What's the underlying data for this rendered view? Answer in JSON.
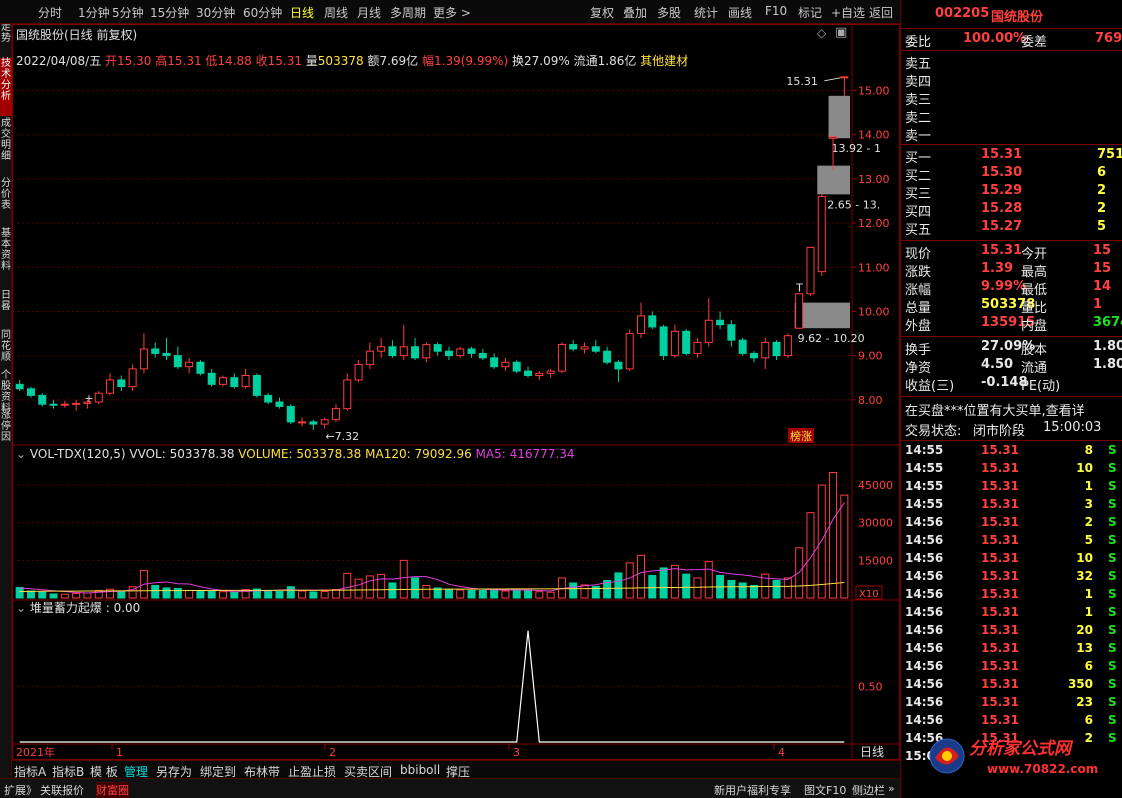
{
  "top_menu": {
    "periods": [
      "分时",
      "1分钟",
      "5分钟",
      "15分钟",
      "30分钟",
      "60分钟",
      "日线",
      "周线",
      "月线",
      "多周期",
      "更多 >"
    ],
    "active_period": "日线",
    "tools": [
      "复权",
      "叠加",
      "多股",
      "统计",
      "画线",
      "F10",
      "标记",
      "+自选",
      "返回"
    ]
  },
  "left_tabs": [
    "分时走势",
    "技术分析",
    "成交明细",
    "分价表",
    "基本资料",
    "日晷",
    "同花顺",
    "个股资料",
    "涨停因"
  ],
  "left_tab_active": 1,
  "main_header": {
    "title": "国统股份(日线 前复权)",
    "info_line": {
      "date": "2022/04/08/五",
      "open_label": "开",
      "open": "15.30",
      "high_label": "高",
      "high": "15.31",
      "low_label": "低",
      "low": "14.88",
      "close_label": "收",
      "close": "15.31",
      "vol_label": "量",
      "vol": "503378",
      "amt_label": "额",
      "amt": "7.69亿",
      "chg_label": "幅",
      "chg": "1.39(9.99%)",
      "turn_label": "换",
      "turn": "27.09%",
      "float_label": "流通",
      "float": "1.86亿",
      "sector": "其他建材"
    }
  },
  "price_axis": [
    "15.00",
    "14.00",
    "13.00",
    "12.00",
    "11.00",
    "10.00",
    "9.00",
    "8.00"
  ],
  "annotations": {
    "high_mark": "15.31",
    "low_mark": "7.32",
    "gap1": "13.92 - 1",
    "gap2": "12.65 - 13.",
    "gap3": "9.62 - 10.20",
    "tag": "榜涨"
  },
  "volume_header": {
    "name": "VOL-TDX(120,5)",
    "vvol": "VVOL: 503378.38",
    "volume": "VOLUME: 503378.38",
    "ma120": "MA120: 79092.96",
    "ma5": "MA5: 416777.34"
  },
  "volume_axis": [
    "45000",
    "30000",
    "15000"
  ],
  "volume_unit": "X10",
  "indicator_header": "堆量蓄力起爆 : 0.00",
  "indicator_axis": "0.50",
  "date_axis": [
    "2021年",
    "1",
    "2",
    "3",
    "4"
  ],
  "timeframe_label": "日线",
  "bottom_tabs": [
    "指标A",
    "指标B",
    "模 板",
    "管理",
    "另存为",
    "绑定到",
    "布林带",
    "止盈止损",
    "买卖区间",
    "bbiboll",
    "撑压"
  ],
  "bottom_active": "管理",
  "status_bar": {
    "left": [
      "扩展》",
      "关联报价",
      "财富圈"
    ],
    "right": [
      "新用户福利专享",
      "图文F10",
      "侧边栏",
      "»"
    ]
  },
  "right_panel": {
    "code": "002205",
    "name": "国统股份",
    "weibi_label": "委比",
    "weibi": "100.00%",
    "weicha_label": "委差",
    "weicha": "769",
    "sells": [
      {
        "label": "卖五",
        "price": "",
        "vol": ""
      },
      {
        "label": "卖四",
        "price": "",
        "vol": ""
      },
      {
        "label": "卖三",
        "price": "",
        "vol": ""
      },
      {
        "label": "卖二",
        "price": "",
        "vol": ""
      },
      {
        "label": "卖一",
        "price": "",
        "vol": ""
      }
    ],
    "buys": [
      {
        "label": "买一",
        "price": "15.31",
        "vol": "751"
      },
      {
        "label": "买二",
        "price": "15.30",
        "vol": "6"
      },
      {
        "label": "买三",
        "price": "15.29",
        "vol": "2"
      },
      {
        "label": "买四",
        "price": "15.28",
        "vol": "2"
      },
      {
        "label": "买五",
        "price": "15.27",
        "vol": "5"
      }
    ],
    "stats": [
      {
        "l1": "现价",
        "v1": "15.31",
        "c1": "red",
        "l2": "今开",
        "v2": "15",
        "c2": "red"
      },
      {
        "l1": "涨跌",
        "v1": "1.39",
        "c1": "red",
        "l2": "最高",
        "v2": "15",
        "c2": "red"
      },
      {
        "l1": "涨幅",
        "v1": "9.99%",
        "c1": "red",
        "l2": "最低",
        "v2": "14",
        "c2": "red"
      },
      {
        "l1": "总量",
        "v1": "503378",
        "c1": "yel",
        "l2": "量比",
        "v2": "1",
        "c2": "red"
      },
      {
        "l1": "外盘",
        "v1": "135915",
        "c1": "red",
        "l2": "内盘",
        "v2": "3674",
        "c2": "grn"
      }
    ],
    "stats2": [
      {
        "l1": "换手",
        "v1": "27.09%",
        "l2": "股本",
        "v2": "1.80"
      },
      {
        "l1": "净资",
        "v1": "4.50",
        "l2": "流通",
        "v2": "1.80"
      },
      {
        "l1": "收益(三)",
        "v1": "-0.148",
        "l2": "PE(动)",
        "v2": ""
      }
    ],
    "notice": "在买盘***位置有大买单,查看详",
    "trade_status_label": "交易状态:",
    "trade_status": "闭市阶段",
    "trade_time": "15:00:03",
    "ticks": [
      {
        "t": "14:55",
        "p": "15.31",
        "v": "8",
        "s": "S"
      },
      {
        "t": "14:55",
        "p": "15.31",
        "v": "10",
        "s": "S"
      },
      {
        "t": "14:55",
        "p": "15.31",
        "v": "1",
        "s": "S"
      },
      {
        "t": "14:55",
        "p": "15.31",
        "v": "3",
        "s": "S"
      },
      {
        "t": "14:56",
        "p": "15.31",
        "v": "2",
        "s": "S"
      },
      {
        "t": "14:56",
        "p": "15.31",
        "v": "5",
        "s": "S"
      },
      {
        "t": "14:56",
        "p": "15.31",
        "v": "10",
        "s": "S"
      },
      {
        "t": "14:56",
        "p": "15.31",
        "v": "32",
        "s": "S"
      },
      {
        "t": "14:56",
        "p": "15.31",
        "v": "1",
        "s": "S"
      },
      {
        "t": "14:56",
        "p": "15.31",
        "v": "1",
        "s": "S"
      },
      {
        "t": "14:56",
        "p": "15.31",
        "v": "20",
        "s": "S"
      },
      {
        "t": "14:56",
        "p": "15.31",
        "v": "13",
        "s": "S"
      },
      {
        "t": "14:56",
        "p": "15.31",
        "v": "6",
        "s": "S"
      },
      {
        "t": "14:56",
        "p": "15.31",
        "v": "350",
        "s": "S"
      },
      {
        "t": "14:56",
        "p": "15.31",
        "v": "23",
        "s": "S"
      },
      {
        "t": "14:56",
        "p": "15.31",
        "v": "6",
        "s": "S"
      },
      {
        "t": "14:56",
        "p": "15.31",
        "v": "2",
        "s": "S"
      },
      {
        "t": "15:00",
        "p": "",
        "v": "",
        "s": ""
      }
    ],
    "watermark_text": "分析家公式网",
    "watermark_url": "www.70822.com"
  },
  "chart_data": {
    "type": "candlestick",
    "ylim": [
      7.0,
      15.6
    ],
    "colors": {
      "up": "#ff3c3c",
      "down": "#00d0a0",
      "ma120": "#ffe040",
      "ma5": "#e040e0"
    },
    "candles": [
      [
        8.35,
        8.45,
        8.2,
        8.25
      ],
      [
        8.25,
        8.3,
        8.05,
        8.1
      ],
      [
        8.1,
        8.15,
        7.85,
        7.9
      ],
      [
        7.9,
        8.0,
        7.8,
        7.88
      ],
      [
        7.88,
        7.98,
        7.82,
        7.9
      ],
      [
        7.9,
        8.0,
        7.75,
        7.92
      ],
      [
        7.92,
        8.0,
        7.8,
        7.95
      ],
      [
        7.95,
        8.2,
        7.9,
        8.15
      ],
      [
        8.15,
        8.6,
        8.1,
        8.45
      ],
      [
        8.45,
        8.55,
        8.2,
        8.3
      ],
      [
        8.3,
        8.8,
        8.2,
        8.7
      ],
      [
        8.7,
        9.5,
        8.6,
        9.15
      ],
      [
        9.15,
        9.3,
        8.95,
        9.05
      ],
      [
        9.05,
        9.4,
        8.9,
        9.0
      ],
      [
        9.0,
        9.2,
        8.7,
        8.75
      ],
      [
        8.75,
        8.95,
        8.6,
        8.85
      ],
      [
        8.85,
        8.9,
        8.55,
        8.6
      ],
      [
        8.6,
        8.7,
        8.3,
        8.35
      ],
      [
        8.35,
        8.55,
        8.3,
        8.5
      ],
      [
        8.5,
        8.6,
        8.25,
        8.3
      ],
      [
        8.3,
        8.7,
        8.25,
        8.55
      ],
      [
        8.55,
        8.6,
        8.05,
        8.1
      ],
      [
        8.1,
        8.15,
        7.9,
        7.95
      ],
      [
        7.95,
        8.05,
        7.8,
        7.85
      ],
      [
        7.85,
        7.9,
        7.45,
        7.5
      ],
      [
        7.5,
        7.6,
        7.4,
        7.5
      ],
      [
        7.5,
        7.55,
        7.32,
        7.45
      ],
      [
        7.45,
        7.6,
        7.35,
        7.55
      ],
      [
        7.55,
        7.9,
        7.5,
        7.8
      ],
      [
        7.8,
        8.6,
        7.75,
        8.45
      ],
      [
        8.45,
        8.9,
        8.4,
        8.8
      ],
      [
        8.8,
        9.3,
        8.7,
        9.1
      ],
      [
        9.1,
        9.4,
        8.95,
        9.2
      ],
      [
        9.2,
        9.35,
        8.95,
        9.0
      ],
      [
        9.0,
        9.7,
        8.9,
        9.2
      ],
      [
        9.2,
        9.4,
        8.9,
        8.95
      ],
      [
        8.95,
        9.3,
        8.85,
        9.25
      ],
      [
        9.25,
        9.3,
        9.0,
        9.1
      ],
      [
        9.1,
        9.2,
        8.9,
        9.0
      ],
      [
        9.0,
        9.2,
        8.95,
        9.15
      ],
      [
        9.15,
        9.2,
        8.95,
        9.05
      ],
      [
        9.05,
        9.15,
        8.9,
        8.95
      ],
      [
        8.95,
        9.05,
        8.7,
        8.75
      ],
      [
        8.75,
        8.95,
        8.65,
        8.85
      ],
      [
        8.85,
        8.9,
        8.6,
        8.65
      ],
      [
        8.65,
        8.75,
        8.5,
        8.55
      ],
      [
        8.55,
        8.65,
        8.45,
        8.6
      ],
      [
        8.6,
        8.7,
        8.5,
        8.65
      ],
      [
        8.65,
        9.3,
        8.6,
        9.25
      ],
      [
        9.25,
        9.35,
        9.1,
        9.15
      ],
      [
        9.15,
        9.3,
        9.05,
        9.2
      ],
      [
        9.2,
        9.35,
        9.05,
        9.1
      ],
      [
        9.1,
        9.2,
        8.8,
        8.85
      ],
      [
        8.85,
        8.9,
        8.4,
        8.7
      ],
      [
        8.7,
        9.6,
        8.65,
        9.5
      ],
      [
        9.5,
        10.2,
        9.4,
        9.9
      ],
      [
        9.9,
        10.0,
        9.6,
        9.65
      ],
      [
        9.65,
        9.7,
        8.9,
        9.0
      ],
      [
        9.0,
        9.7,
        8.95,
        9.55
      ],
      [
        9.55,
        9.6,
        9.0,
        9.05
      ],
      [
        9.05,
        9.4,
        8.95,
        9.3
      ],
      [
        9.3,
        10.3,
        9.2,
        9.8
      ],
      [
        9.8,
        10.0,
        9.6,
        9.7
      ],
      [
        9.7,
        9.8,
        9.2,
        9.35
      ],
      [
        9.35,
        9.4,
        9.0,
        9.05
      ],
      [
        9.05,
        9.1,
        8.85,
        8.95
      ],
      [
        8.95,
        9.4,
        8.7,
        9.3
      ],
      [
        9.3,
        9.35,
        8.9,
        9.0
      ],
      [
        9.0,
        9.5,
        8.95,
        9.45
      ],
      [
        9.62,
        10.4,
        9.6,
        10.4
      ],
      [
        10.4,
        11.45,
        10.35,
        11.45
      ],
      [
        10.9,
        12.65,
        10.8,
        12.6
      ],
      [
        13.92,
        13.95,
        13.2,
        13.95
      ],
      [
        15.3,
        15.31,
        14.88,
        15.31
      ]
    ],
    "volume_max": 55000,
    "volumes": [
      4200,
      2800,
      2300,
      1600,
      1500,
      1800,
      2000,
      3000,
      3500,
      2500,
      4500,
      11000,
      5000,
      4000,
      3800,
      3000,
      2600,
      2800,
      2500,
      2200,
      3400,
      3600,
      2600,
      2600,
      4500,
      2800,
      2400,
      2600,
      3400,
      9800,
      7500,
      8800,
      9400,
      6000,
      15000,
      8000,
      5000,
      4000,
      3500,
      3200,
      3000,
      3000,
      3500,
      2800,
      3400,
      2800,
      2500,
      2300,
      8000,
      6000,
      5200,
      4600,
      7000,
      10000,
      14000,
      17000,
      9000,
      12000,
      13000,
      9500,
      8000,
      14500,
      9000,
      7000,
      6000,
      5000,
      9500,
      7000,
      8000,
      20000,
      34000,
      45000,
      50000,
      41000
    ],
    "vol_ma5": [
      4000,
      3700,
      3300,
      2900,
      2600,
      2200,
      2000,
      2300,
      2600,
      2700,
      3300,
      5500,
      6100,
      6400,
      5700,
      5600,
      4500,
      3600,
      3000,
      2500,
      2600,
      2900,
      2900,
      3200,
      3300,
      3100,
      3100,
      3200,
      3100,
      4200,
      5200,
      6800,
      7600,
      7500,
      8100,
      8500,
      8500,
      7300,
      5500,
      4600,
      3900,
      3500,
      3300,
      3200,
      3200,
      3200,
      3000,
      2800,
      3800,
      4300,
      4900,
      5300,
      6200,
      6600,
      8000,
      10100,
      10800,
      11100,
      11700,
      11200,
      11300,
      11500,
      10200,
      9600,
      9200,
      8600,
      7900,
      7600,
      7400,
      10200,
      16000,
      22900,
      31400,
      38000
    ],
    "vol_ma120": [
      2600,
      2650,
      2700,
      2720,
      2740,
      2760,
      2780,
      2800,
      2820,
      2840,
      2860,
      2900,
      2920,
      2940,
      2960,
      2980,
      3000,
      3010,
      3020,
      3030,
      3040,
      3050,
      3060,
      3070,
      3080,
      3090,
      3100,
      3110,
      3120,
      3150,
      3200,
      3250,
      3300,
      3330,
      3400,
      3450,
      3480,
      3500,
      3520,
      3540,
      3560,
      3580,
      3600,
      3610,
      3620,
      3630,
      3640,
      3650,
      3700,
      3730,
      3760,
      3790,
      3830,
      3880,
      3950,
      4030,
      4080,
      4140,
      4200,
      4250,
      4300,
      4380,
      4420,
      4460,
      4490,
      4520,
      4570,
      4610,
      4650,
      4800,
      5050,
      5400,
      5800,
      6200
    ],
    "indicator": {
      "spike_index": 45,
      "spike_value": 1.0,
      "ylim": [
        0,
        1.15
      ]
    },
    "gaps": [
      {
        "low": 13.92,
        "high": 14.88,
        "label_key": "gap1"
      },
      {
        "low": 12.65,
        "high": 13.3,
        "label_key": "gap2"
      },
      {
        "low": 9.62,
        "high": 10.2,
        "label_key": "gap3"
      }
    ]
  }
}
